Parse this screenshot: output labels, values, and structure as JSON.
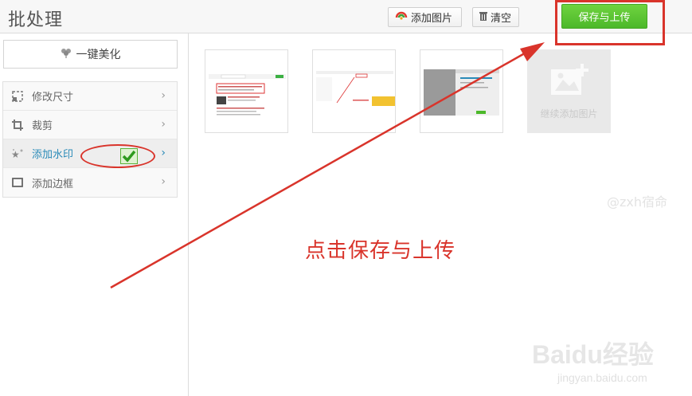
{
  "header": {
    "title": "批处理",
    "add_image_label": "添加图片",
    "clear_label": "清空",
    "save_upload_label": "保存与上传"
  },
  "sidebar": {
    "beautify_label": "一键美化",
    "items": [
      {
        "label": "修改尺寸",
        "icon": "resize-icon"
      },
      {
        "label": "裁剪",
        "icon": "crop-icon"
      },
      {
        "label": "添加水印",
        "icon": "watermark-icon"
      },
      {
        "label": "添加边框",
        "icon": "border-icon"
      }
    ]
  },
  "gallery": {
    "add_more_label": "继续添加图片"
  },
  "annotation": {
    "text": "点击保存与上传"
  },
  "watermark": {
    "author": "@zxh宿命",
    "logo": "Baidu经验",
    "url": "jingyan.baidu.com"
  },
  "colors": {
    "accent_green": "#4cb82a",
    "annotation_red": "#d9342b",
    "active_blue": "#2a8bb8"
  }
}
